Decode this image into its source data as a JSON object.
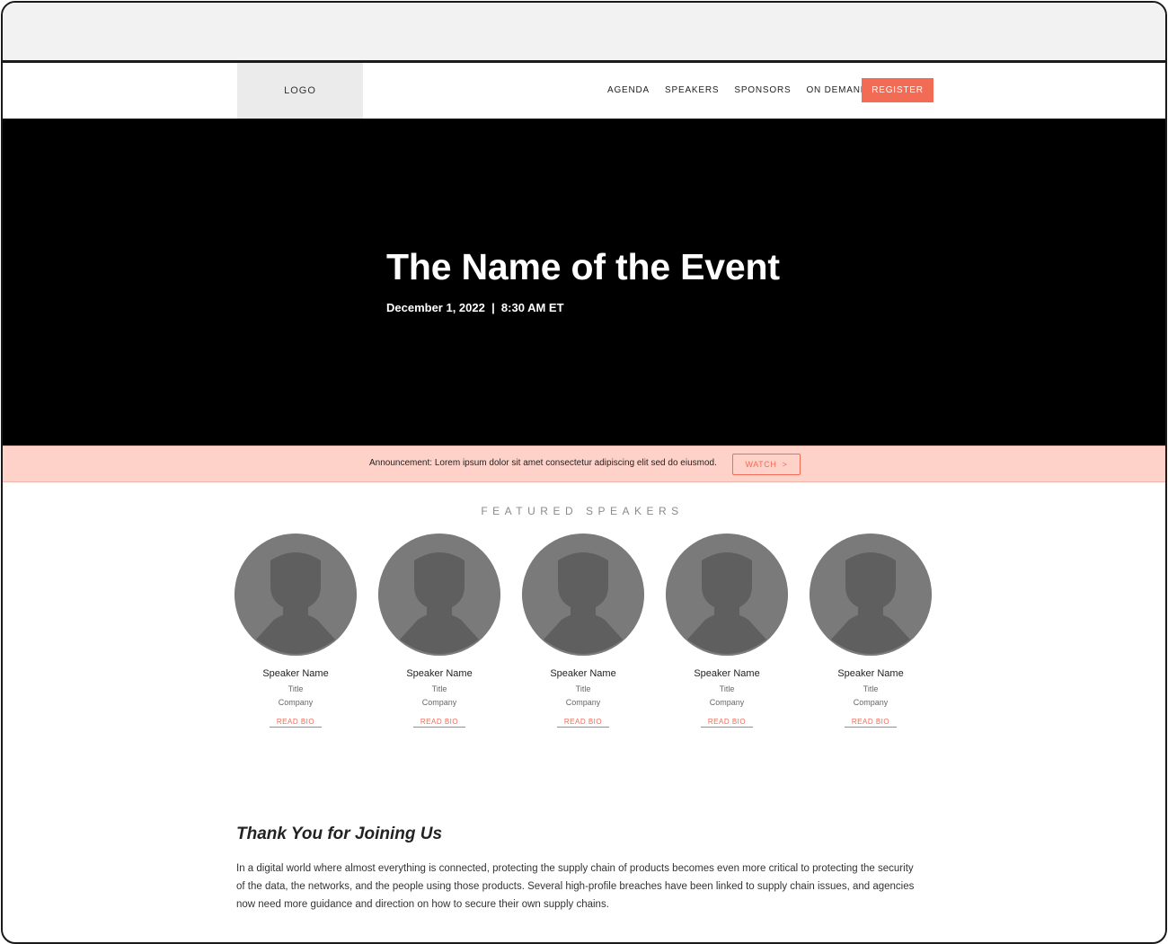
{
  "header": {
    "logo": "LOGO",
    "nav": [
      "AGENDA",
      "SPEAKERS",
      "SPONSORS",
      "ON DEMAND"
    ],
    "register": "REGISTER"
  },
  "hero": {
    "title": "The Name of the Event",
    "date": "December 1, 2022  |  8:30 AM ET"
  },
  "announcement": {
    "text": "Announcement: Lorem ipsum dolor sit amet consectetur adipiscing elit sed do eiusmod.",
    "button": "WATCH  >"
  },
  "speakers": {
    "heading": "FEATURED SPEAKERS",
    "items": [
      {
        "name": "Speaker Name",
        "title": "Title",
        "company": "Company",
        "link": "READ BIO"
      },
      {
        "name": "Speaker Name",
        "title": "Title",
        "company": "Company",
        "link": "READ BIO"
      },
      {
        "name": "Speaker Name",
        "title": "Title",
        "company": "Company",
        "link": "READ BIO"
      },
      {
        "name": "Speaker Name",
        "title": "Title",
        "company": "Company",
        "link": "READ BIO"
      },
      {
        "name": "Speaker Name",
        "title": "Title",
        "company": "Company",
        "link": "READ BIO"
      }
    ]
  },
  "thank_you": {
    "heading": "Thank You for Joining Us",
    "body": "In a digital world where almost everything is connected, protecting the supply chain of products becomes even more critical to protecting the security of the data, the networks, and the people using those products. Several high-profile breaches have been linked to supply chain issues, and agencies now need more guidance and direction on how to secure their own supply chains."
  },
  "colors": {
    "accent": "#f26b55",
    "announcement_bg": "#ffd2c9",
    "hero_bg": "#000000"
  }
}
